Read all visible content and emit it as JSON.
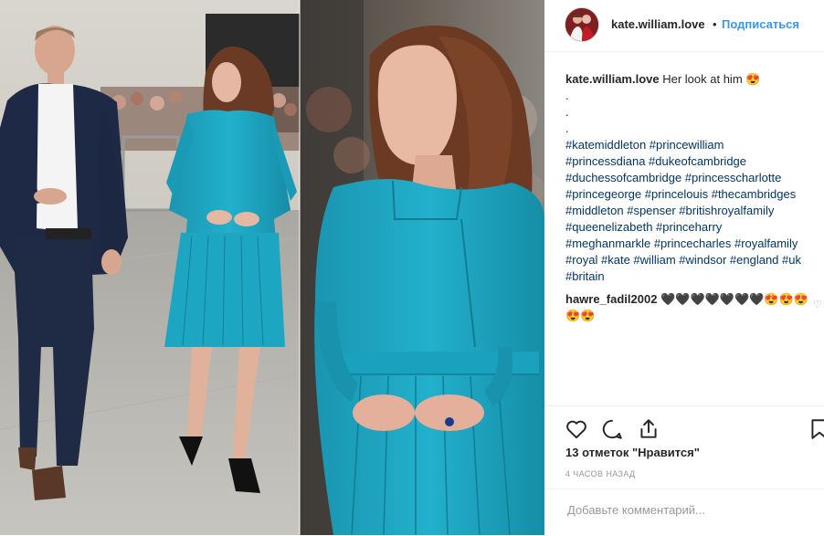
{
  "header": {
    "username": "kate.william.love",
    "separator": "•",
    "follow_label": "Подписаться"
  },
  "caption": {
    "username": "kate.william.love",
    "text": "Her look at him 😍",
    "lines": [
      ".",
      ".",
      "."
    ],
    "hashtag_lines": [
      "#katemiddleton #princewilliam",
      "#princessdiana #dukeofcambridge",
      "#duchessofcambridge #princesscharlotte",
      "#princegeorge #princelouis #thecambridges",
      "#middleton #spenser #britishroyalfamily",
      "#queenelizabeth #princeharry",
      "#meghanmarkle #princecharles #royalfamily",
      "#royal #kate #william #windsor #england #uk",
      "#britain"
    ]
  },
  "comment": {
    "username": "hawre_fadil2002",
    "text": "🖤🖤🖤🖤🖤🖤🖤😍😍😍",
    "text_line2": "😍😍"
  },
  "actions": {
    "icons": [
      "heart-icon",
      "comment-icon",
      "share-icon",
      "bookmark-icon"
    ]
  },
  "likes": "13 отметок \"Нравится\"",
  "timestamp": "4 ЧАСОВ НАЗАД",
  "add_comment": {
    "placeholder": "Добавьте комментарий..."
  },
  "colors": {
    "link_blue": "#3897f0",
    "hashtag": "#003569",
    "dress_teal": "#1aa3bf",
    "muted_text": "#999999"
  }
}
